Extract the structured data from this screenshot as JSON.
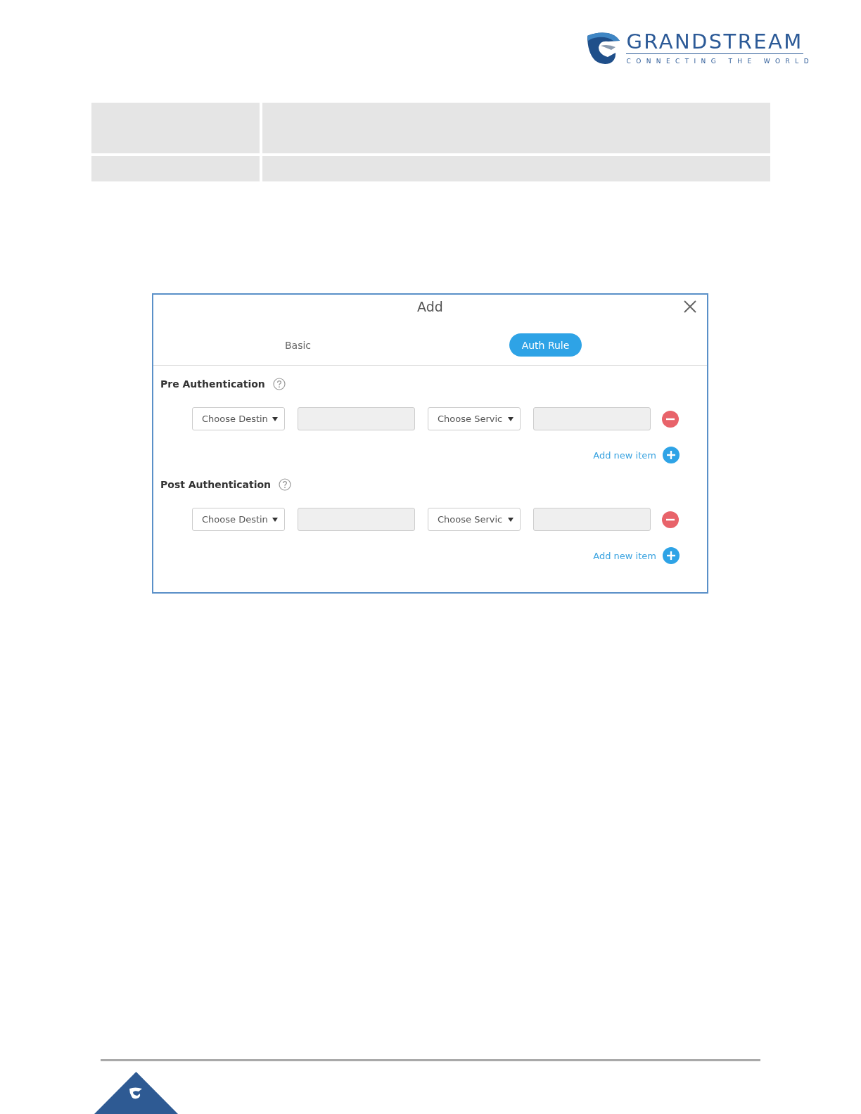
{
  "header": {
    "brand_name": "GRANDSTREAM",
    "tagline": "CONNECTING THE WORLD"
  },
  "table": {
    "rows": [
      {
        "kind": "tall"
      },
      {
        "kind": "short"
      }
    ]
  },
  "dialog": {
    "title": "Add",
    "tabs": [
      {
        "label": "Basic",
        "selected": false
      },
      {
        "label": "Auth Rule",
        "selected": true
      }
    ],
    "sections": [
      {
        "title": "Pre Authentication",
        "items": [
          {
            "fields": [
              {
                "kind": "select",
                "value": "Choose Destin"
              },
              {
                "kind": "input",
                "disabled": true
              },
              {
                "kind": "select",
                "value": "Choose Servic"
              },
              {
                "kind": "input",
                "disabled": true
              }
            ]
          }
        ],
        "add_label": "Add new item"
      },
      {
        "title": "Post Authentication",
        "items": [
          {
            "fields": [
              {
                "kind": "select",
                "value": "Choose Destin"
              },
              {
                "kind": "input",
                "disabled": true
              },
              {
                "kind": "select",
                "value": "Choose Servic"
              },
              {
                "kind": "input",
                "disabled": true
              }
            ]
          }
        ],
        "add_label": "Add new item"
      }
    ]
  }
}
